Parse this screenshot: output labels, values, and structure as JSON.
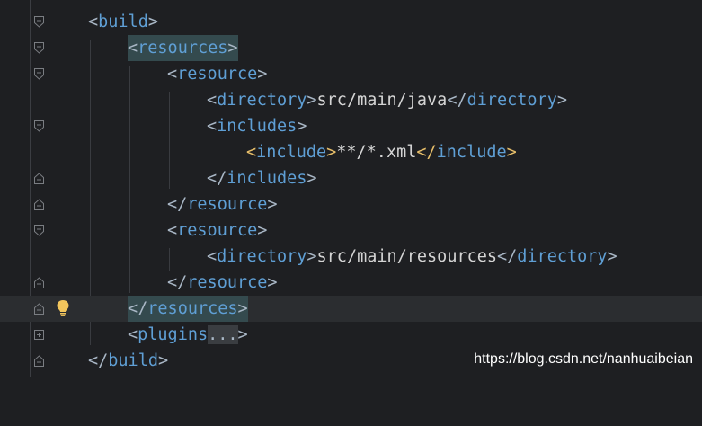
{
  "editor": {
    "lines": [
      {
        "open": "<",
        "name": "build",
        "close": ">"
      },
      {
        "open": "<",
        "name": "resources",
        "close": ">"
      },
      {
        "open": "<",
        "name": "resource",
        "close": ">"
      },
      {
        "open": "<",
        "name": "directory",
        "close": ">",
        "text": "src/main/java",
        "end_open": "</",
        "end_name": "directory",
        "end_close": ">"
      },
      {
        "open": "<",
        "name": "includes",
        "close": ">"
      },
      {
        "open": "<",
        "name": "include",
        "close": ">",
        "text": "**/*.xml",
        "end_open": "</",
        "end_name": "include",
        "end_close": ">"
      },
      {
        "open": "</",
        "name": "includes",
        "close": ">"
      },
      {
        "open": "</",
        "name": "resource",
        "close": ">"
      },
      {
        "open": "<",
        "name": "resource",
        "close": ">"
      },
      {
        "open": "<",
        "name": "directory",
        "close": ">",
        "text": "src/main/resources",
        "end_open": "</",
        "end_name": "directory",
        "end_close": ">"
      },
      {
        "open": "</",
        "name": "resource",
        "close": ">"
      },
      {
        "open": "</",
        "name": "resources",
        "close": ">"
      },
      {
        "open": "<",
        "name": "plugins",
        "placeholder": "...",
        "close": ">"
      },
      {
        "open": "</",
        "name": "build",
        "close": ">"
      }
    ]
  },
  "watermark": "https://blog.csdn.net/nanhuaibeian",
  "colors": {
    "background": "#1e1f22",
    "tag": "#5f9fd5",
    "matched_tag": "#e8bf6a",
    "text": "#d4d4d4",
    "highlight": "#344a4e",
    "current_line": "#2b2d30"
  },
  "icons": {
    "fold_open": "fold-open-icon",
    "fold_close": "fold-close-icon",
    "fold_expand": "fold-expand-icon",
    "intention": "lightbulb-icon"
  }
}
